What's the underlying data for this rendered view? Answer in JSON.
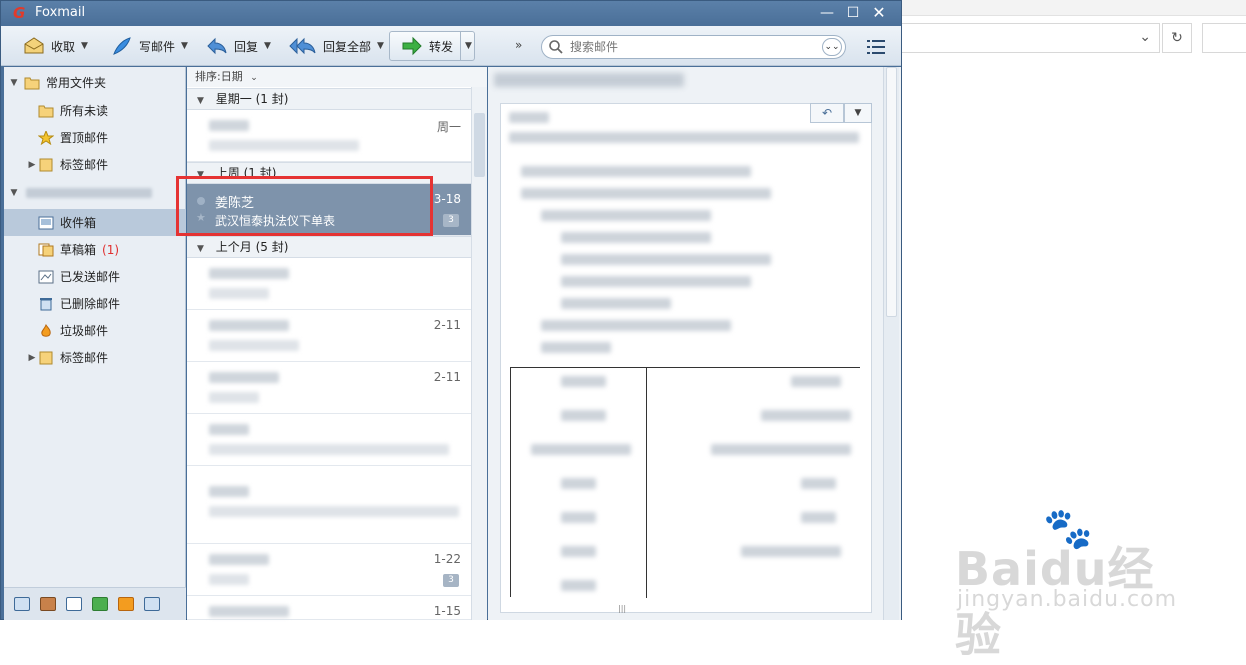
{
  "window": {
    "title": "Foxmail",
    "controls": [
      "minimize",
      "maximize",
      "close"
    ]
  },
  "toolbar": {
    "receive": "收取",
    "compose": "写邮件",
    "reply": "回复",
    "reply_all": "回复全部",
    "forward": "转发",
    "more": "»",
    "search_placeholder": "搜索邮件"
  },
  "sidebar": {
    "common_folders": "常用文件夹",
    "all_unread": "所有未读",
    "pinned": "置顶邮件",
    "tagged": "标签邮件",
    "inbox": "收件箱",
    "drafts": "草稿箱",
    "drafts_count": "(1)",
    "sent": "已发送邮件",
    "deleted": "已删除邮件",
    "junk": "垃圾邮件",
    "tagged2": "标签邮件"
  },
  "mail_list": {
    "sort_label": "排序:日期",
    "groups": {
      "monday": "星期一 (1 封)",
      "last_week": "上周 (1 封)",
      "last_month": "上个月 (5 封)"
    },
    "items": [
      {
        "sender": "",
        "subject": "",
        "date": "周一",
        "badge": ""
      },
      {
        "sender": "姜陈芝",
        "subject": "武汉恒泰执法仪下单表",
        "date": "3-18",
        "badge": "3"
      },
      {
        "sender": "",
        "subject": "",
        "date": "",
        "badge": ""
      },
      {
        "sender": "",
        "subject": "",
        "date": "2-11",
        "badge": ""
      },
      {
        "sender": "",
        "subject": "",
        "date": "2-11",
        "badge": ""
      },
      {
        "sender": "",
        "subject": "",
        "date": "",
        "badge": ""
      },
      {
        "sender": "",
        "subject": "",
        "date": "",
        "badge": ""
      },
      {
        "sender": "",
        "subject": "",
        "date": "1-22",
        "badge": "3"
      },
      {
        "sender": "",
        "subject": "",
        "date": "1-15",
        "badge": ""
      }
    ]
  },
  "watermark": {
    "main": "Baidu经验",
    "sub": "jingyan.baidu.com"
  },
  "colors": {
    "title_bar": "#4a6f98",
    "selected_item": "#7e93ab",
    "highlight_border": "#e53333",
    "draft_count": "#e03030"
  }
}
